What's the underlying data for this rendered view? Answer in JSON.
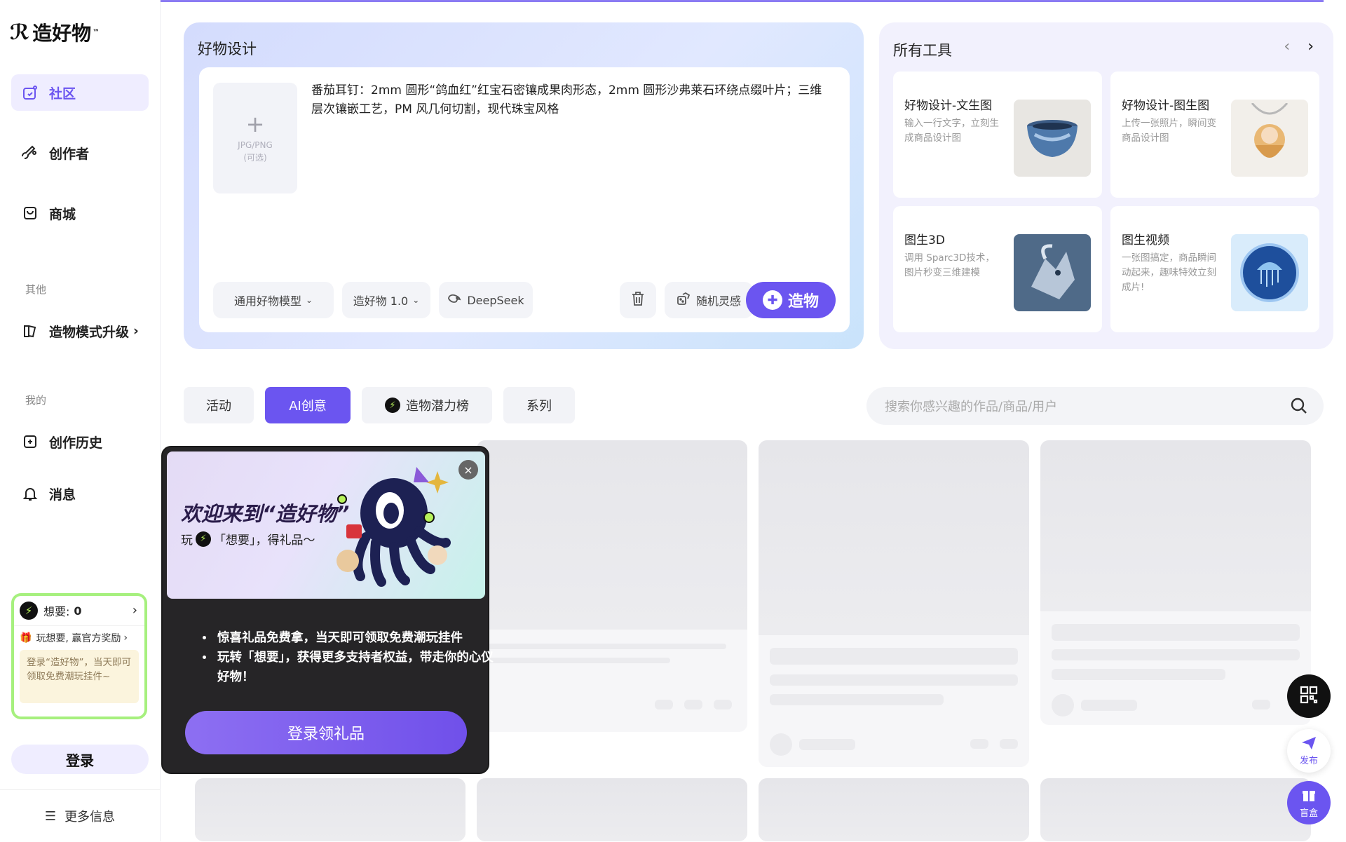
{
  "brand": {
    "name": "造好物",
    "tm": "™"
  },
  "sidebar": {
    "items": [
      {
        "label": "社区"
      },
      {
        "label": "创作者"
      },
      {
        "label": "商城"
      },
      {
        "label": "造物模式升级"
      },
      {
        "label": "创作历史"
      },
      {
        "label": "消息"
      }
    ],
    "section_other": "其他",
    "section_mine": "我的",
    "want": {
      "label": "想要:",
      "count": "0",
      "reward": "玩想要, 赢官方奖励",
      "note": "登录“造好物”，当天即可领取免费潮玩挂件~"
    },
    "login": "登录",
    "more_info": "更多信息"
  },
  "design": {
    "title": "好物设计",
    "upload_type": "JPG/PNG",
    "upload_optional": "(可选)",
    "prompt": "番茄耳钉：2mm 圆形“鸽血红”红宝石密镶成果肉形态，2mm 圆形沙弗莱石环绕点缀叶片；三维层次镶嵌工艺，PM 风几何切割，现代珠宝风格",
    "model": "通用好物模型",
    "version": "造好物 1.0",
    "deepseek": "DeepSeek",
    "random": "随机灵感",
    "create": "造物"
  },
  "tools": {
    "title": "所有工具",
    "cards": [
      {
        "name": "好物设计-文生图",
        "desc": "输入一行文字，立刻生成商品设计图"
      },
      {
        "name": "好物设计-图生图",
        "desc": "上传一张照片，瞬间变商品设计图"
      },
      {
        "name": "图生3D",
        "desc": "调用 Sparc3D技术，图片秒变三维建模"
      },
      {
        "name": "图生视频",
        "desc": "一张图搞定，商品瞬间动起来，趣味特效立刻成片!"
      }
    ]
  },
  "tabs": [
    {
      "label": "活动"
    },
    {
      "label": "AI创意"
    },
    {
      "label": "造物潜力榜"
    },
    {
      "label": "系列"
    }
  ],
  "search": {
    "placeholder": "搜索你感兴趣的作品/商品/用户"
  },
  "popup": {
    "title": "欢迎来到“造好物”",
    "sub_prefix": "玩",
    "sub_suffix": "「想要」，得礼品～",
    "bullets": [
      "惊喜礼品免费拿，当天即可领取免费潮玩挂件",
      "玩转「想要」，获得更多支持者权益，带走你的心仪好物！"
    ],
    "button": "登录领礼品"
  },
  "floats": {
    "publish": "发布",
    "blind_box": "盲盒"
  },
  "colors": {
    "accent": "#6b55f0",
    "want_green": "#a6f07e"
  }
}
